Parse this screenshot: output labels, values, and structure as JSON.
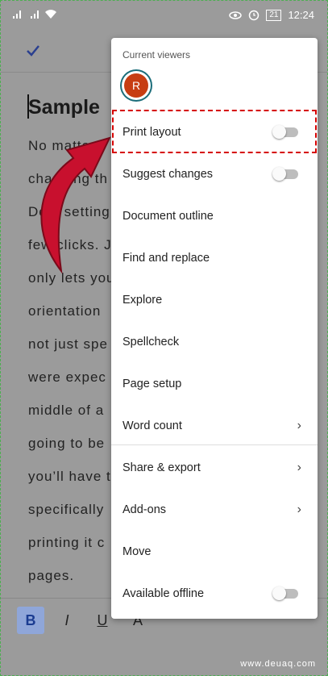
{
  "status_bar": {
    "clock": "12:24",
    "battery_level": "21",
    "icons": [
      "signal-icon",
      "signal-icon",
      "wifi-icon",
      "eye-icon",
      "alarm-icon",
      "battery-icon"
    ]
  },
  "document": {
    "title_fragment": "Sample",
    "lines": [
      "No matter t",
      "changing th",
      "Doc, setting",
      "few clicks. J",
      "only lets you",
      "orientation",
      "not just spe",
      "were expec",
      "middle of a",
      "going to be",
      "you’ll have t",
      "specifically",
      "printing it c",
      "pages."
    ]
  },
  "toolbar": {
    "bold": "B",
    "italic": "I",
    "underline": "U",
    "text_color": "A"
  },
  "menu": {
    "header": "Current viewers",
    "avatar_initial": "R",
    "items": [
      {
        "label": "Print layout",
        "toggle": false
      },
      {
        "label": "Suggest changes",
        "toggle": false
      },
      {
        "label": "Document outline"
      },
      {
        "label": "Find and replace"
      },
      {
        "label": "Explore"
      },
      {
        "label": "Spellcheck"
      },
      {
        "label": "Page setup"
      },
      {
        "label": "Word count"
      },
      {
        "label": "Share & export"
      },
      {
        "label": "Add-ons"
      },
      {
        "label": "Move"
      },
      {
        "label": "Available offline",
        "toggle": false
      }
    ]
  },
  "watermark": "www.deuaq.com",
  "colors": {
    "accent_blue": "#2a3f8f",
    "avatar_bg": "#c73d12",
    "highlight_red": "#d50000",
    "arrow_red": "#c8102e"
  }
}
